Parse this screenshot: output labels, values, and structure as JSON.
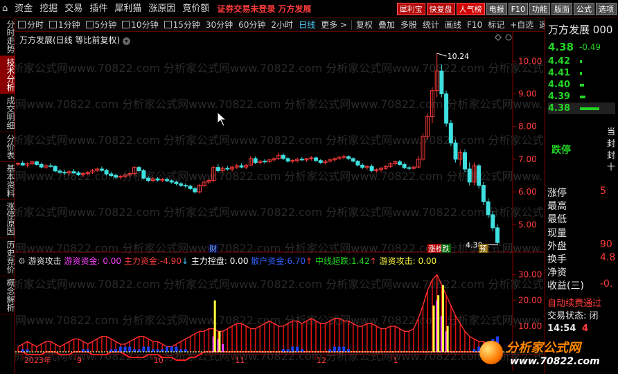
{
  "menu": {
    "items": [
      "资金",
      "挖掘",
      "交易",
      "插件",
      "犀利猫",
      "涨原因",
      "竞价额"
    ],
    "warning": "证券交易未登录",
    "brand": "万方发展",
    "right_buttons": [
      "犀利宝",
      "快复盘",
      "人气榜",
      "电报",
      "F10",
      "功能",
      "版面",
      "公式",
      "选项"
    ]
  },
  "sidebar": {
    "items": [
      "分时走势",
      "技术分析",
      "成交明细",
      "分价表",
      "基本资料",
      "涨停原因",
      "历史竞价",
      "概念解析"
    ],
    "active_index": 1
  },
  "periodbar": {
    "periods": [
      "分时",
      "1分钟",
      "5分钟",
      "10分钟",
      "15分钟",
      "30分钟",
      "60分钟",
      "2小时",
      "日线",
      "更多 >"
    ],
    "selected": "日线",
    "tools": [
      "复权",
      "叠加",
      "多股",
      "统计",
      "画线",
      "F10",
      "标记",
      "+自选",
      "返回"
    ]
  },
  "chart_header": {
    "title": "万方发展(日线 等比前复权)",
    "hint_icon": "circle-chevron-icon",
    "corner_icons": [
      "diamond-icon",
      "circle-icon"
    ]
  },
  "annotations": {
    "high": "10.24",
    "low": "4.38",
    "tags": [
      "财",
      "涨榜",
      "跌",
      "预"
    ]
  },
  "watermark": "分析家公式网www.70822.com",
  "price_axis": [
    "10.00",
    "9.00",
    "8.00",
    "7.00",
    "6.00",
    "5.00"
  ],
  "indicator_axis": [
    "30.00",
    "20.00",
    "10.00"
  ],
  "time_axis": [
    "2023年",
    "9",
    "10",
    "11",
    "12",
    "1"
  ],
  "indicator": {
    "name": "游资攻击",
    "items": [
      {
        "label": "游资资金:",
        "value": "0.00",
        "color": "#ff40ff"
      },
      {
        "label": "主力资金:",
        "value": "-4.90",
        "color": "#ff3b3b"
      },
      {
        "label": "主力控盘:",
        "value": "0.00",
        "color": "#ffffff"
      },
      {
        "label": "散户资金:",
        "value": "6.70",
        "color": "#3060ff"
      },
      {
        "label": "中线超跌:",
        "value": "1.42",
        "color": "#23d323"
      },
      {
        "label": "游资攻击:",
        "value": "0.00",
        "color": "#ffff40"
      }
    ]
  },
  "right_panel": {
    "name": "万方发展",
    "code_suffix": "000",
    "price": "4.38",
    "change": "-0.49",
    "bids": [
      {
        "price": "4.42",
        "bar": 0.05
      },
      {
        "price": "4.41",
        "bar": 0.05
      },
      {
        "price": "4.40",
        "bar": 0.15
      },
      {
        "price": "4.39",
        "bar": 0.2
      },
      {
        "price": "4.38",
        "bar": 0.7
      }
    ],
    "limit_label": "跌停",
    "side_chars": [
      "当",
      "封",
      "封",
      "十"
    ],
    "rows": [
      {
        "label": "涨停",
        "value": "5"
      },
      {
        "label": "最高",
        "value": ""
      },
      {
        "label": "最低",
        "value": ""
      },
      {
        "label": "现量",
        "value": ""
      },
      {
        "label": "外盘",
        "value": "90"
      },
      {
        "label": "换手",
        "value": "4.8"
      },
      {
        "label": "净资",
        "value": ""
      },
      {
        "label": "收益(三)",
        "value": "-0."
      }
    ],
    "fee": "自动续费通过",
    "state": "交易状态: 闭",
    "tick_time": "14:54",
    "tick_price": "4",
    "logo_text": "分析家公式网",
    "logo_url": "www.70822.com"
  },
  "chart_data": {
    "type": "candlestick",
    "title": "万方发展(日线 等比前复权)",
    "y_price_range": [
      4.2,
      10.6
    ],
    "y_indicator_range": [
      0,
      35
    ],
    "candles": [
      [
        6.85,
        6.9,
        6.8,
        6.88
      ],
      [
        6.88,
        6.95,
        6.8,
        6.82
      ],
      [
        6.82,
        6.9,
        6.75,
        6.86
      ],
      [
        6.86,
        6.95,
        6.82,
        6.92
      ],
      [
        6.92,
        6.95,
        6.8,
        6.84
      ],
      [
        6.84,
        6.9,
        6.72,
        6.76
      ],
      [
        6.76,
        6.85,
        6.7,
        6.8
      ],
      [
        6.8,
        6.88,
        6.74,
        6.78
      ],
      [
        6.78,
        6.82,
        6.6,
        6.64
      ],
      [
        6.64,
        6.7,
        6.55,
        6.6
      ],
      [
        6.6,
        6.68,
        6.52,
        6.58
      ],
      [
        6.58,
        6.66,
        6.5,
        6.62
      ],
      [
        6.62,
        6.7,
        6.55,
        6.58
      ],
      [
        6.58,
        6.64,
        6.48,
        6.52
      ],
      [
        6.52,
        6.6,
        6.45,
        6.56
      ],
      [
        6.56,
        6.64,
        6.5,
        6.6
      ],
      [
        6.6,
        6.7,
        6.55,
        6.66
      ],
      [
        6.66,
        6.74,
        6.6,
        6.7
      ],
      [
        6.7,
        6.78,
        6.62,
        6.66
      ],
      [
        6.66,
        6.7,
        6.5,
        6.55
      ],
      [
        6.55,
        6.62,
        6.45,
        6.5
      ],
      [
        6.5,
        6.56,
        6.4,
        6.45
      ],
      [
        6.45,
        6.52,
        6.38,
        6.48
      ],
      [
        6.48,
        6.56,
        6.42,
        6.52
      ],
      [
        6.52,
        6.6,
        6.45,
        6.56
      ],
      [
        6.56,
        6.8,
        6.5,
        6.75
      ],
      [
        6.75,
        6.8,
        6.6,
        6.65
      ],
      [
        6.65,
        6.7,
        6.38,
        6.42
      ],
      [
        6.42,
        6.48,
        6.3,
        6.35
      ],
      [
        6.35,
        6.45,
        6.3,
        6.4
      ],
      [
        6.4,
        6.45,
        6.32,
        6.36
      ],
      [
        6.36,
        6.42,
        6.3,
        6.38
      ],
      [
        6.38,
        6.44,
        6.3,
        6.34
      ],
      [
        6.34,
        6.38,
        6.25,
        6.3
      ],
      [
        6.3,
        6.34,
        6.2,
        6.25
      ],
      [
        6.25,
        6.3,
        6.15,
        6.2
      ],
      [
        6.2,
        6.26,
        6.12,
        6.18
      ],
      [
        6.18,
        6.22,
        6.05,
        6.1
      ],
      [
        6.1,
        6.15,
        5.95,
        6.0
      ],
      [
        6.0,
        6.25,
        5.95,
        6.2
      ],
      [
        6.2,
        6.35,
        6.15,
        6.3
      ],
      [
        6.3,
        6.4,
        6.25,
        6.35
      ],
      [
        6.35,
        6.8,
        6.3,
        6.75
      ],
      [
        6.75,
        6.85,
        6.6,
        6.65
      ],
      [
        6.65,
        6.78,
        6.6,
        6.72
      ],
      [
        6.72,
        6.8,
        6.65,
        6.7
      ],
      [
        6.7,
        6.8,
        6.62,
        6.76
      ],
      [
        6.76,
        6.86,
        6.7,
        6.8
      ],
      [
        6.8,
        6.88,
        6.72,
        6.76
      ],
      [
        6.76,
        6.85,
        6.7,
        6.82
      ],
      [
        6.82,
        7.1,
        6.8,
        7.02
      ],
      [
        7.02,
        7.08,
        6.85,
        6.9
      ],
      [
        6.9,
        6.98,
        6.84,
        6.94
      ],
      [
        6.94,
        7.0,
        6.86,
        6.92
      ],
      [
        6.92,
        7.0,
        6.88,
        6.98
      ],
      [
        6.98,
        7.06,
        6.92,
        7.02
      ],
      [
        7.02,
        7.2,
        6.98,
        7.12
      ],
      [
        7.12,
        7.18,
        6.98,
        7.02
      ],
      [
        7.02,
        7.06,
        6.9,
        6.94
      ],
      [
        6.94,
        7.0,
        6.88,
        6.96
      ],
      [
        6.96,
        7.04,
        6.9,
        7.0
      ],
      [
        7.0,
        7.06,
        6.94,
        6.98
      ],
      [
        6.98,
        7.04,
        6.92,
        7.02
      ],
      [
        7.02,
        7.1,
        6.96,
        7.04
      ],
      [
        7.04,
        7.08,
        6.92,
        6.96
      ],
      [
        6.96,
        7.0,
        6.86,
        6.9
      ],
      [
        6.9,
        6.98,
        6.84,
        6.94
      ],
      [
        6.94,
        7.02,
        6.9,
        6.98
      ],
      [
        6.98,
        7.06,
        6.94,
        7.02
      ],
      [
        7.02,
        7.1,
        6.98,
        7.06
      ],
      [
        7.06,
        7.14,
        7.0,
        7.08
      ],
      [
        7.08,
        7.12,
        6.98,
        7.02
      ],
      [
        7.02,
        7.06,
        6.9,
        6.94
      ],
      [
        6.94,
        6.98,
        6.78,
        6.82
      ],
      [
        6.82,
        6.88,
        6.7,
        6.75
      ],
      [
        6.75,
        6.82,
        6.68,
        6.78
      ],
      [
        6.78,
        6.84,
        6.6,
        6.65
      ],
      [
        6.65,
        6.72,
        6.58,
        6.68
      ],
      [
        6.68,
        6.76,
        6.62,
        6.72
      ],
      [
        6.72,
        6.82,
        6.68,
        6.78
      ],
      [
        6.78,
        6.9,
        6.74,
        6.86
      ],
      [
        6.86,
        6.96,
        6.82,
        6.92
      ],
      [
        6.92,
        6.98,
        6.8,
        6.84
      ],
      [
        6.84,
        6.9,
        6.7,
        6.74
      ],
      [
        6.74,
        6.8,
        6.66,
        6.72
      ],
      [
        6.72,
        6.8,
        6.68,
        6.76
      ],
      [
        6.76,
        7.1,
        6.72,
        7.0
      ],
      [
        7.0,
        7.8,
        6.95,
        7.7
      ],
      [
        7.7,
        8.4,
        7.6,
        8.3
      ],
      [
        8.3,
        9.2,
        8.1,
        9.1
      ],
      [
        9.1,
        10.24,
        8.9,
        9.7
      ],
      [
        9.7,
        9.9,
        8.9,
        9.0
      ],
      [
        9.0,
        9.1,
        8.0,
        8.1
      ],
      [
        8.1,
        8.2,
        7.4,
        7.5
      ],
      [
        7.5,
        7.6,
        6.9,
        7.0
      ],
      [
        7.0,
        7.3,
        6.8,
        7.2
      ],
      [
        7.2,
        7.3,
        6.6,
        6.7
      ],
      [
        6.7,
        6.9,
        6.2,
        6.3
      ],
      [
        6.3,
        6.9,
        6.2,
        6.8
      ],
      [
        6.8,
        6.85,
        6.1,
        6.2
      ],
      [
        6.2,
        6.3,
        5.6,
        5.7
      ],
      [
        5.7,
        5.8,
        5.2,
        5.3
      ],
      [
        5.3,
        5.4,
        4.8,
        4.9
      ],
      [
        4.9,
        5.0,
        4.38,
        4.45
      ]
    ],
    "indicator_series": {
      "main_red": [
        2,
        3,
        4,
        3,
        2,
        3,
        4,
        4,
        3,
        2,
        3,
        4,
        5,
        5,
        4,
        3,
        4,
        5,
        6,
        6,
        5,
        4,
        3,
        3,
        4,
        5,
        6,
        6,
        5,
        4,
        4,
        3,
        2,
        2,
        3,
        4,
        5,
        6,
        7,
        8,
        8,
        9,
        9,
        8,
        8,
        9,
        10,
        11,
        11,
        10,
        9,
        9,
        10,
        11,
        12,
        11,
        10,
        10,
        11,
        12,
        12,
        11,
        12,
        13,
        12,
        11,
        11,
        12,
        13,
        13,
        12,
        12,
        11,
        10,
        10,
        11,
        11,
        10,
        9,
        9,
        10,
        10,
        9,
        8,
        8,
        9,
        13,
        18,
        24,
        28,
        30,
        26,
        22,
        18,
        14,
        11,
        8,
        6,
        5,
        4,
        4,
        3,
        2,
        1
      ],
      "bottom_red_line": [
        0,
        0,
        -1,
        -1,
        -1,
        -1,
        0,
        0,
        0,
        -1,
        -1,
        -1,
        0,
        0,
        0,
        0,
        -1,
        -1,
        -1,
        -1,
        0,
        0,
        0,
        -1,
        -2,
        -2,
        -2,
        -2,
        -1,
        -1,
        -1,
        -2,
        -2,
        -2,
        -3,
        -3,
        -3,
        -2,
        -2,
        -1,
        0,
        0,
        0,
        0,
        0,
        0,
        0,
        0,
        0,
        0,
        0,
        0,
        0,
        0,
        0,
        0,
        0,
        0,
        0,
        0,
        0,
        0,
        0,
        0,
        0,
        0,
        0,
        0,
        0,
        0,
        0,
        0,
        0,
        0,
        0,
        0,
        0,
        0,
        0,
        0,
        0,
        0,
        0,
        0,
        0,
        0,
        0,
        0,
        0,
        0,
        0,
        0,
        0,
        0,
        0,
        0,
        0,
        0,
        0,
        0,
        0,
        0,
        0,
        0
      ],
      "magenta": [
        0,
        0,
        0,
        0,
        0,
        0,
        0,
        0,
        0,
        0,
        0,
        0,
        0,
        0,
        0,
        0,
        0,
        0,
        0,
        0,
        0,
        0,
        0,
        0,
        0,
        0,
        0,
        0,
        0,
        0,
        0,
        0,
        0,
        0,
        0,
        0,
        0,
        0,
        0,
        0,
        0,
        0,
        6,
        5,
        3,
        0,
        0,
        0,
        0,
        0,
        0,
        0,
        0,
        0,
        0,
        0,
        0,
        0,
        0,
        0,
        0,
        0,
        0,
        0,
        0,
        0,
        0,
        0,
        0,
        0,
        0,
        0,
        0,
        0,
        0,
        0,
        0,
        0,
        0,
        0,
        0,
        0,
        0,
        0,
        0,
        0,
        0,
        0,
        0,
        0,
        20,
        14,
        8,
        0,
        0,
        0,
        0,
        0,
        0,
        0,
        0,
        0,
        0,
        0
      ],
      "yellow": [
        0,
        0,
        0,
        0,
        0,
        0,
        0,
        0,
        0,
        0,
        0,
        0,
        0,
        0,
        0,
        0,
        0,
        0,
        0,
        0,
        0,
        0,
        0,
        0,
        0,
        0,
        0,
        0,
        0,
        0,
        0,
        0,
        0,
        0,
        0,
        0,
        0,
        0,
        0,
        0,
        0,
        0,
        20,
        8,
        0,
        0,
        0,
        0,
        0,
        0,
        0,
        0,
        0,
        0,
        0,
        0,
        0,
        0,
        0,
        0,
        0,
        0,
        0,
        0,
        0,
        0,
        0,
        0,
        0,
        0,
        0,
        0,
        0,
        0,
        0,
        0,
        0,
        0,
        0,
        0,
        0,
        0,
        0,
        0,
        0,
        0,
        0,
        0,
        0,
        18,
        22,
        26,
        10,
        0,
        0,
        0,
        0,
        0,
        0,
        0,
        0,
        0,
        0,
        0
      ],
      "blue": [
        0,
        1,
        1,
        0,
        0,
        0,
        0,
        0,
        0,
        0,
        0,
        0,
        0,
        0,
        1,
        1,
        0,
        0,
        0,
        0,
        1,
        1,
        2,
        2,
        2,
        1,
        1,
        2,
        2,
        1,
        1,
        1,
        2,
        2,
        2,
        1,
        1,
        0,
        0,
        0,
        0,
        0,
        0,
        0,
        0,
        0,
        0,
        0,
        0,
        0,
        0,
        0,
        0,
        0,
        0,
        0,
        0,
        1,
        1,
        2,
        2,
        1,
        0,
        0,
        0,
        0,
        0,
        1,
        2,
        2,
        2,
        1,
        0,
        0,
        0,
        0,
        0,
        0,
        0,
        0,
        0,
        0,
        0,
        0,
        0,
        0,
        0,
        0,
        0,
        0,
        0,
        0,
        0,
        0,
        0,
        0,
        0,
        0,
        1,
        2,
        2,
        4,
        5,
        6
      ]
    }
  }
}
